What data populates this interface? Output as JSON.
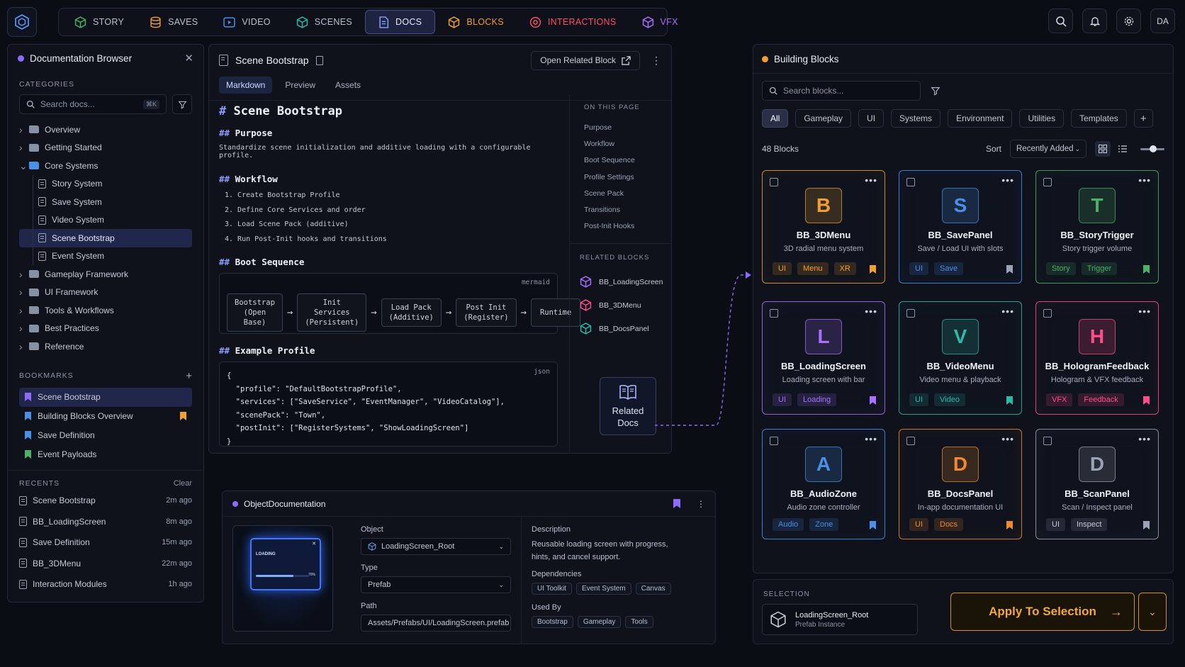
{
  "nav": {
    "items": [
      {
        "label": "STORY",
        "icon": "cube-icon",
        "color": "#4caf6a"
      },
      {
        "label": "SAVES",
        "icon": "database-icon",
        "color": "#e39b3a"
      },
      {
        "label": "VIDEO",
        "icon": "play-icon",
        "color": "#4a8fe8"
      },
      {
        "label": "SCENES",
        "icon": "cube-icon",
        "color": "#2fb7a8"
      },
      {
        "label": "DOCS",
        "icon": "document-icon",
        "color": "#8e9cff"
      },
      {
        "label": "BLOCKS",
        "icon": "cube-icon",
        "color": "#f0a030"
      },
      {
        "label": "INTERACTIONS",
        "icon": "target-icon",
        "color": "#ff4d6a"
      },
      {
        "label": "VFX",
        "icon": "cube-icon",
        "color": "#a970ff"
      }
    ],
    "avatar": "DA"
  },
  "doc_browser": {
    "title": "Documentation Browser",
    "categories_label": "CATEGORIES",
    "search_placeholder": "Search docs...",
    "search_shortcut": "⌘K",
    "tree": [
      {
        "label": "Overview",
        "type": "folder",
        "expanded": false
      },
      {
        "label": "Getting Started",
        "type": "folder",
        "expanded": false
      },
      {
        "label": "Core Systems",
        "type": "folder",
        "expanded": true
      },
      {
        "label": "Story System",
        "type": "doc"
      },
      {
        "label": "Save System",
        "type": "doc"
      },
      {
        "label": "Video System",
        "type": "doc"
      },
      {
        "label": "Scene Bootstrap",
        "type": "doc",
        "selected": true
      },
      {
        "label": "Event System",
        "type": "doc"
      },
      {
        "label": "Gameplay Framework",
        "type": "folder",
        "expanded": false
      },
      {
        "label": "UI Framework",
        "type": "folder",
        "expanded": false
      },
      {
        "label": "Tools & Workflows",
        "type": "folder",
        "expanded": false
      },
      {
        "label": "Best Practices",
        "type": "folder",
        "expanded": false
      },
      {
        "label": "Reference",
        "type": "folder",
        "expanded": false
      }
    ],
    "bookmarks_label": "BOOKMARKS",
    "bookmarks": [
      {
        "label": "Scene Bootstrap",
        "color": "#8b6cff"
      },
      {
        "label": "Building Blocks Overview",
        "color": "#4a8fe8",
        "flag_color": "#f0a030"
      },
      {
        "label": "Save Definition",
        "color": "#4a8fe8"
      },
      {
        "label": "Event Payloads",
        "color": "#4caf6a"
      }
    ],
    "recents_label": "RECENTS",
    "recents_clear": "Clear",
    "recents": [
      {
        "label": "Scene Bootstrap",
        "time": "2m ago"
      },
      {
        "label": "BB_LoadingScreen",
        "time": "8m ago"
      },
      {
        "label": "Save Definition",
        "time": "15m ago"
      },
      {
        "label": "BB_3DMenu",
        "time": "22m ago"
      },
      {
        "label": "Interaction Modules",
        "time": "1h ago"
      }
    ]
  },
  "doc": {
    "title": "Scene Bootstrap",
    "open_related": "Open Related Block",
    "tabs": [
      "Markdown",
      "Preview",
      "Assets"
    ],
    "h1": "Scene Bootstrap",
    "purpose_h": "Purpose",
    "purpose_text": "Standardize scene initialization and additive loading with a configurable profile.",
    "workflow_h": "Workflow",
    "workflow": [
      "1. Create Bootstrap Profile",
      "2. Define Core Services and order",
      "3. Load Scene Pack (additive)",
      "4. Run Post-Init hooks and transitions"
    ],
    "boot_h": "Boot Sequence",
    "mermaid_label": "mermaid",
    "flow": [
      {
        "line1": "Bootstrap",
        "line2": "(Open Base)"
      },
      {
        "line1": "Init Services",
        "line2": "(Persistent)"
      },
      {
        "line1": "Load Pack",
        "line2": "(Additive)"
      },
      {
        "line1": "Post Init",
        "line2": "(Register)"
      },
      {
        "line1": "Runtime",
        "line2": ""
      }
    ],
    "example_h": "Example Profile",
    "json_label": "json",
    "code": [
      "{",
      "  \"profile\": \"DefaultBootstrapProfile\",",
      "  \"services\": [\"SaveService\", \"EventManager\", \"VideoCatalog\"],",
      "  \"scenePack\": \"Town\",",
      "  \"postInit\": [\"RegisterSystems\", \"ShowLoadingScreen\"]",
      "}"
    ],
    "on_this_page_label": "ON THIS PAGE",
    "on_this_page": [
      "Purpose",
      "Workflow",
      "Boot Sequence",
      "Profile Settings",
      "Scene Pack",
      "Transitions",
      "Post-Init Hooks"
    ],
    "related_label": "RELATED BLOCKS",
    "related": [
      {
        "label": "BB_LoadingScreen",
        "color": "#a970ff"
      },
      {
        "label": "BB_3DMenu",
        "color": "#ff4d8a"
      },
      {
        "label": "BB_DocsPanel",
        "color": "#2fb7a8"
      }
    ],
    "related_docs": "Related Docs"
  },
  "objdoc": {
    "title": "ObjectDocumentation",
    "preview_title": "LOADING",
    "preview_progress": "70%",
    "preview_progress_value": 0.7,
    "object_label": "Object",
    "object_value": "LoadingScreen_Root",
    "type_label": "Type",
    "type_value": "Prefab",
    "path_label": "Path",
    "path_value": "Assets/Prefabs/UI/LoadingScreen.prefab",
    "description_label": "Description",
    "description": "Reusable loading screen with progress, hints, and cancel support.",
    "dependencies_label": "Dependencies",
    "dependencies": [
      "UI Toolkit",
      "Event System",
      "Canvas"
    ],
    "used_by_label": "Used By",
    "used_by": [
      "Bootstrap",
      "Gameplay",
      "Tools"
    ]
  },
  "blocks": {
    "title": "Building Blocks",
    "search_placeholder": "Search blocks...",
    "filters": [
      "All",
      "Gameplay",
      "UI",
      "Systems",
      "Environment",
      "Utilities",
      "Templates"
    ],
    "count": "48 Blocks",
    "sort_label": "Sort",
    "sort_value": "Recently Added",
    "cards": [
      {
        "letter": "B",
        "name": "BB_3DMenu",
        "desc": "3D radial menu system",
        "tags": [
          "UI",
          "Menu",
          "XR"
        ],
        "accent": "#f0a030",
        "bookmarked": true
      },
      {
        "letter": "S",
        "name": "BB_SavePanel",
        "desc": "Save / Load UI with slots",
        "tags": [
          "UI",
          "Save"
        ],
        "accent": "#4a8fe8",
        "bookmarked": false
      },
      {
        "letter": "T",
        "name": "BB_StoryTrigger",
        "desc": "Story trigger volume",
        "tags": [
          "Story",
          "Trigger"
        ],
        "accent": "#4caf6a",
        "bookmarked": true
      },
      {
        "letter": "L",
        "name": "BB_LoadingScreen",
        "desc": "Loading screen with bar",
        "tags": [
          "UI",
          "Loading"
        ],
        "accent": "#a970ff",
        "bookmarked": true
      },
      {
        "letter": "V",
        "name": "BB_VideoMenu",
        "desc": "Video menu & playback",
        "tags": [
          "UI",
          "Video"
        ],
        "accent": "#2fb7a8",
        "bookmarked": true
      },
      {
        "letter": "H",
        "name": "BB_HologramFeedback",
        "desc": "Hologram & VFX feedback",
        "tags": [
          "VFX",
          "Feedback"
        ],
        "accent": "#ff4d8a",
        "bookmarked": true
      },
      {
        "letter": "A",
        "name": "BB_AudioZone",
        "desc": "Audio zone controller",
        "tags": [
          "Audio",
          "Zone"
        ],
        "accent": "#4a8fe8",
        "bookmarked": true
      },
      {
        "letter": "D",
        "name": "BB_DocsPanel",
        "desc": "In-app documentation UI",
        "tags": [
          "UI",
          "Docs"
        ],
        "accent": "#f08a30",
        "bookmarked": true
      },
      {
        "letter": "D",
        "name": "BB_ScanPanel",
        "desc": "Scan / Inspect panel",
        "tags": [
          "UI",
          "Inspect"
        ],
        "accent": "#9aa2b3",
        "bookmarked": false
      }
    ]
  },
  "selection": {
    "label": "SELECTION",
    "name": "LoadingScreen_Root",
    "sub": "Prefab Instance",
    "apply": "Apply To Selection"
  }
}
